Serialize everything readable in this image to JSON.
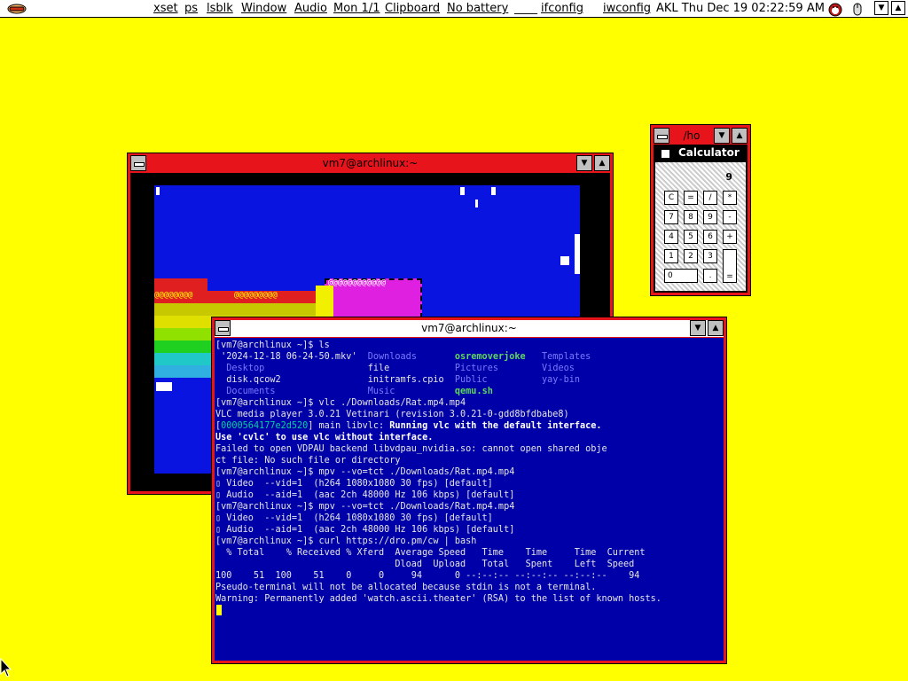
{
  "topbar": {
    "items": [
      "xset",
      "ps",
      "lsblk",
      "Window",
      "Audio",
      "Mon 1/1",
      "Clipboard",
      "No battery",
      "____",
      "ifconfig",
      "iwconfig",
      "AKL Thu Dec 19 02:22:59 AM"
    ],
    "logo_icon": "hotdog-icon",
    "tray_icons": [
      "penguin-icon",
      "mouse-icon"
    ],
    "scroll_down": "▼",
    "scroll_up": "▲"
  },
  "back_window": {
    "title": "vm7@archlinux:~",
    "colors": {
      "frame": "#e8141c",
      "canvas": "#0a14e0"
    },
    "artifact_labels": [
      "@@@@@@@@",
      "@@@@@@@@@@@@",
      "@@@@@@@@@"
    ]
  },
  "calc_window": {
    "title": "/ho",
    "calc_title": "Calculator",
    "display": "9",
    "keys": [
      [
        "C",
        "=",
        "/",
        "*"
      ],
      [
        "7",
        "8",
        "9",
        "-"
      ],
      [
        "4",
        "5",
        "6",
        "+"
      ],
      [
        "1",
        "2",
        "3",
        ""
      ],
      [
        "0",
        ".",
        "="
      ]
    ]
  },
  "front_window": {
    "title": "vm7@archlinux:~",
    "colors": {
      "frame": "#e8141c",
      "bg": "#0000a8"
    },
    "lines": [
      [
        {
          "t": "[vm7@archlinux ~]$ ls"
        }
      ],
      [
        {
          "t": " '2024-12-18 06-24-50.mkv'  "
        },
        {
          "t": "Downloads",
          "c": "c-dir"
        },
        {
          "t": "       "
        },
        {
          "t": "osremoverjoke",
          "c": "c-hi"
        },
        {
          "t": "   "
        },
        {
          "t": "Templates",
          "c": "c-dir"
        }
      ],
      [
        {
          "t": "  "
        },
        {
          "t": "Desktop",
          "c": "c-dir"
        },
        {
          "t": "                   file            "
        },
        {
          "t": "Pictures",
          "c": "c-dir"
        },
        {
          "t": "        "
        },
        {
          "t": "Videos",
          "c": "c-dir"
        }
      ],
      [
        {
          "t": "  disk.qcow2                initramfs.cpio  "
        },
        {
          "t": "Public",
          "c": "c-dir"
        },
        {
          "t": "          "
        },
        {
          "t": "yay-bin",
          "c": "c-dir"
        }
      ],
      [
        {
          "t": "  "
        },
        {
          "t": "Documents",
          "c": "c-dir"
        },
        {
          "t": "                 "
        },
        {
          "t": "Music",
          "c": "c-dir"
        },
        {
          "t": "           "
        },
        {
          "t": "qemu.sh",
          "c": "c-hi"
        }
      ],
      [
        {
          "t": "[vm7@archlinux ~]$ vlc ./Downloads/Rat.mp4.mp4"
        }
      ],
      [
        {
          "t": "VLC media player 3.0.21 Vetinari (revision 3.0.21-0-gdd8bfdbabe8)"
        }
      ],
      [
        {
          "t": "["
        },
        {
          "t": "0000564177e2d520",
          "c": "c-ok"
        },
        {
          "t": "] main libvlc: "
        },
        {
          "t": "Running vlc with the default interface.",
          "c": "c-w"
        }
      ],
      [
        {
          "t": "Use 'cvlc' to use vlc without interface.",
          "c": "c-w"
        }
      ],
      [
        {
          "t": "Failed to open VDPAU backend libvdpau_nvidia.so: cannot open shared obje"
        }
      ],
      [
        {
          "t": "ct file: No such file or directory"
        }
      ],
      [
        {
          "t": "[vm7@archlinux ~]$ mpv --vo=tct ./Downloads/Rat.mp4.mp4"
        }
      ],
      [
        {
          "t": "▯ Video  --vid=1  (h264 1080x1080 30 fps) [default]"
        }
      ],
      [
        {
          "t": "▯ Audio  --aid=1  (aac 2ch 48000 Hz 106 kbps) [default]"
        }
      ],
      [
        {
          "t": "[vm7@archlinux ~]$ mpv --vo=tct ./Downloads/Rat.mp4.mp4"
        }
      ],
      [
        {
          "t": "▯ Video  --vid=1  (h264 1080x1080 30 fps) [default]"
        }
      ],
      [
        {
          "t": "▯ Audio  --aid=1  (aac 2ch 48000 Hz 106 kbps) [default]"
        }
      ],
      [
        {
          "t": "[vm7@archlinux ~]$ curl https://dro.pm/cw | bash"
        }
      ],
      [
        {
          "t": "  % Total    % Received % Xferd  Average Speed   Time    Time     Time  Current"
        }
      ],
      [
        {
          "t": "                                 Dload  Upload   Total   Spent    Left  Speed"
        }
      ],
      [
        {
          "t": "100    51  100    51    0     0     94      0 --:--:-- --:--:-- --:--:--    94"
        }
      ],
      [
        {
          "t": "Pseudo-terminal will not be allocated because stdin is not a terminal."
        }
      ],
      [
        {
          "t": "Warning: Permanently added 'watch.ascii.theater' (RSA) to the list of known hosts."
        }
      ]
    ]
  },
  "desktop": {
    "background": "#ffff00"
  },
  "cursor_icon": "arrow-cursor-icon"
}
